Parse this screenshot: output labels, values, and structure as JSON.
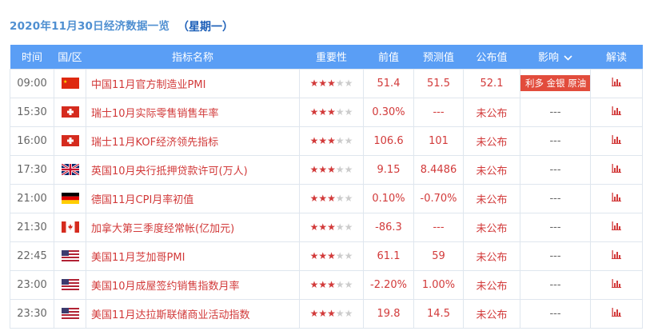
{
  "header": {
    "date_title": "2020年11月30日经济数据一览",
    "weekday": "（星期一）"
  },
  "columns": {
    "time": "时间",
    "region": "国/区",
    "indicator": "指标名称",
    "importance": "重要性",
    "previous": "前值",
    "forecast": "预测值",
    "actual": "公布值",
    "impact": "影响",
    "analysis": "解读"
  },
  "colors": {
    "accent": "#5a9ef5",
    "highlight": "#d23a3a",
    "impact_badge": "#e24c3c"
  },
  "rows": [
    {
      "time": "09:00",
      "country": "china",
      "flag_icon": "china-flag-icon",
      "name": "中国11月官方制造业PMI",
      "stars": 3,
      "previous": "51.4",
      "forecast": "51.5",
      "actual": "52.1",
      "impact": "利多 金银 原油",
      "impact_badge": true
    },
    {
      "time": "15:30",
      "country": "switzerland",
      "flag_icon": "switzerland-flag-icon",
      "name": "瑞士10月实际零售销售年率",
      "stars": 3,
      "previous": "0.30%",
      "forecast": "---",
      "actual": "未公布",
      "impact": "---"
    },
    {
      "time": "16:00",
      "country": "switzerland",
      "flag_icon": "switzerland-flag-icon",
      "name": "瑞士11月KOF经济领先指标",
      "stars": 3,
      "previous": "106.6",
      "forecast": "101",
      "actual": "未公布",
      "impact": "---"
    },
    {
      "time": "17:30",
      "country": "uk",
      "flag_icon": "uk-flag-icon",
      "name": "英国10月央行抵押贷款许可(万人)",
      "stars": 3,
      "previous": "9.15",
      "forecast": "8.4486",
      "actual": "未公布",
      "impact": "---"
    },
    {
      "time": "21:00",
      "country": "germany",
      "flag_icon": "germany-flag-icon",
      "name": "德国11月CPI月率初值",
      "stars": 3,
      "previous": "0.10%",
      "forecast": "-0.70%",
      "actual": "未公布",
      "impact": "---"
    },
    {
      "time": "21:30",
      "country": "canada",
      "flag_icon": "canada-flag-icon",
      "name": "加拿大第三季度经常帐(亿加元)",
      "stars": 3,
      "previous": "-86.3",
      "forecast": "---",
      "actual": "未公布",
      "impact": "---"
    },
    {
      "time": "22:45",
      "country": "usa",
      "flag_icon": "usa-flag-icon",
      "name": "美国11月芝加哥PMI",
      "stars": 3,
      "previous": "61.1",
      "forecast": "59",
      "actual": "未公布",
      "impact": "---"
    },
    {
      "time": "23:00",
      "country": "usa",
      "flag_icon": "usa-flag-icon",
      "name": "美国10月成屋签约销售指数月率",
      "stars": 3,
      "previous": "-2.20%",
      "forecast": "1.00%",
      "actual": "未公布",
      "impact": "---"
    },
    {
      "time": "23:30",
      "country": "usa",
      "flag_icon": "usa-flag-icon",
      "name": "美国11月达拉斯联储商业活动指数",
      "stars": 3,
      "previous": "19.8",
      "forecast": "14.5",
      "actual": "未公布",
      "impact": "---"
    }
  ]
}
